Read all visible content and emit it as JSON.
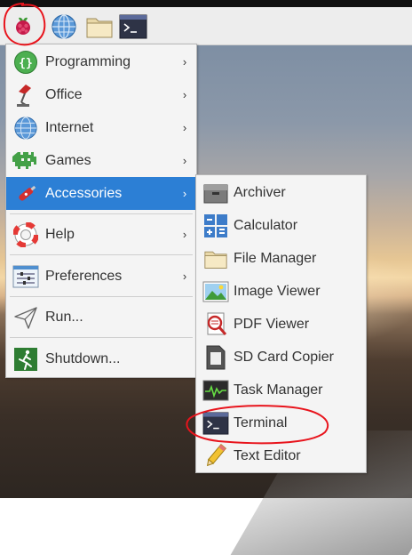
{
  "taskbar": {
    "buttons": [
      {
        "name": "raspberry-menu-button",
        "icon": "raspberry-icon"
      },
      {
        "name": "web-browser-button",
        "icon": "globe-icon"
      },
      {
        "name": "file-manager-button",
        "icon": "folder-icon"
      },
      {
        "name": "terminal-button",
        "icon": "terminal-icon"
      }
    ]
  },
  "main_menu": {
    "items": [
      {
        "label": "Programming",
        "icon": "programming-icon",
        "arrow": "›"
      },
      {
        "label": "Office",
        "icon": "office-icon",
        "arrow": "›"
      },
      {
        "label": "Internet",
        "icon": "globe-icon",
        "arrow": "›"
      },
      {
        "label": "Games",
        "icon": "games-icon",
        "arrow": "›"
      },
      {
        "label": "Accessories",
        "icon": "accessories-icon",
        "arrow": "›",
        "selected": true
      },
      {
        "label": "Help",
        "icon": "lifebuoy-icon",
        "arrow": "›"
      },
      {
        "label": "Preferences",
        "icon": "preferences-icon",
        "arrow": "›"
      },
      {
        "label": "Run...",
        "icon": "run-icon"
      },
      {
        "label": "Shutdown...",
        "icon": "shutdown-icon"
      }
    ]
  },
  "accessories_menu": {
    "items": [
      {
        "label": "Archiver",
        "icon": "archiver-icon"
      },
      {
        "label": "Calculator",
        "icon": "calculator-icon"
      },
      {
        "label": "File Manager",
        "icon": "folder-icon"
      },
      {
        "label": "Image Viewer",
        "icon": "image-viewer-icon"
      },
      {
        "label": "PDF Viewer",
        "icon": "pdf-viewer-icon"
      },
      {
        "label": "SD Card Copier",
        "icon": "sd-card-icon"
      },
      {
        "label": "Task Manager",
        "icon": "task-manager-icon"
      },
      {
        "label": "Terminal",
        "icon": "terminal-icon"
      },
      {
        "label": "Text Editor",
        "icon": "text-editor-icon"
      }
    ]
  },
  "colors": {
    "selection": "#2c7fd5",
    "annotation": "#e8141c",
    "menu_bg": "#f4f4f4"
  }
}
